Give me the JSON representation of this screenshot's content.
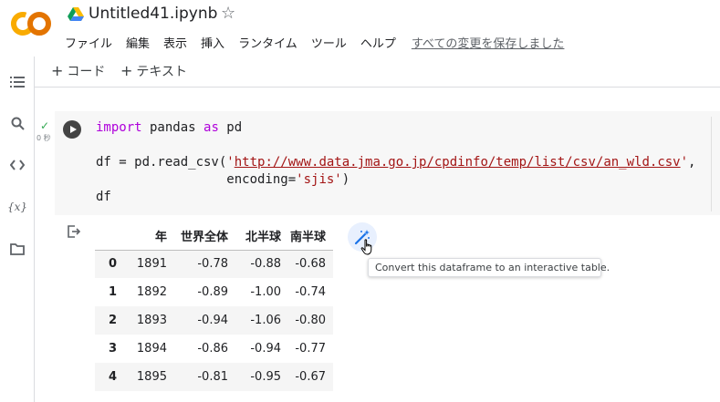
{
  "header": {
    "logo_text": "CO",
    "title": "Untitled41.ipynb",
    "star_glyph": "☆"
  },
  "menu": {
    "items": [
      "ファイル",
      "編集",
      "表示",
      "挿入",
      "ランタイム",
      "ツール",
      "ヘルプ"
    ],
    "saved_status": "すべての変更を保存しました"
  },
  "sidebar": {
    "icons": [
      "toc-icon",
      "search-icon",
      "code-snippets-icon",
      "variables-icon",
      "files-icon"
    ],
    "variables_glyph": "{x}"
  },
  "toolbar": {
    "plus": "+",
    "add_code_label": "コード",
    "add_text_label": "テキスト"
  },
  "cell": {
    "status_glyph": "✓",
    "exec_time": "0 秒",
    "code": {
      "line1": {
        "kw1": "import",
        "t1": " pandas ",
        "kw2": "as",
        "t2": " pd"
      },
      "line3": {
        "t1": "df = pd.read_csv(",
        "q1": "'",
        "url": "http://www.data.jma.go.jp/cpdinfo/temp/list/csv/an_wld.csv",
        "q2": "'",
        "t2": ","
      },
      "line4": {
        "t1": "                 encoding=",
        "str": "'sjis'",
        "t2": ")"
      },
      "line5": "df"
    }
  },
  "output": {
    "columns": [
      "",
      "年",
      "世界全体",
      "北半球",
      "南半球"
    ],
    "rows": [
      [
        "0",
        "1891",
        "-0.78",
        "-0.88",
        "-0.68"
      ],
      [
        "1",
        "1892",
        "-0.89",
        "-1.00",
        "-0.74"
      ],
      [
        "2",
        "1893",
        "-0.94",
        "-1.06",
        "-0.80"
      ],
      [
        "3",
        "1894",
        "-0.86",
        "-0.94",
        "-0.77"
      ],
      [
        "4",
        "1895",
        "-0.81",
        "-0.95",
        "-0.67"
      ]
    ],
    "tooltip": "Convert this dataframe to an interactive table."
  },
  "colors": {
    "logo_orange": "#f9ab00",
    "logo_dark_orange": "#e37400",
    "keyword": "#af00db",
    "string": "#a31515",
    "check_green": "#34a853"
  }
}
